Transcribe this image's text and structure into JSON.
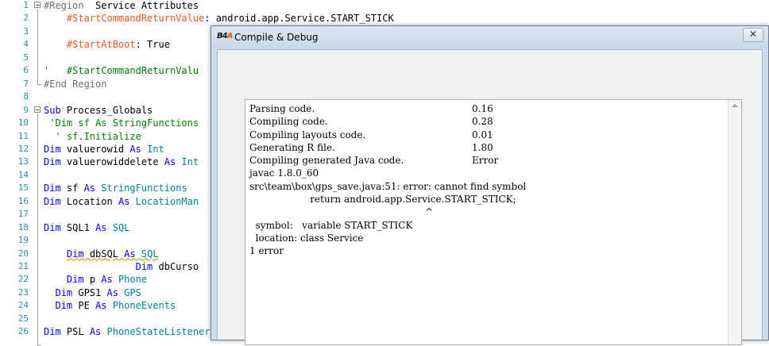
{
  "editor": {
    "lines": [
      {
        "num": "1",
        "segs": [
          {
            "c": "reg",
            "t": "#Region  "
          },
          {
            "c": "str",
            "t": "Service Attributes"
          }
        ]
      },
      {
        "num": "2",
        "segs": [
          {
            "c": "str",
            "t": "    "
          },
          {
            "c": "dir",
            "t": "#StartCommandReturnValue"
          },
          {
            "c": "str",
            "t": ": android.app.Service.START_STICK"
          }
        ]
      },
      {
        "num": "3",
        "segs": []
      },
      {
        "num": "4",
        "segs": [
          {
            "c": "str",
            "t": "    "
          },
          {
            "c": "dir",
            "t": "#StartAtBoot"
          },
          {
            "c": "str",
            "t": ": True"
          }
        ]
      },
      {
        "num": "5",
        "segs": []
      },
      {
        "num": "6",
        "segs": [
          {
            "c": "cm",
            "t": "'   "
          },
          {
            "c": "cm",
            "t": "#StartCommandReturnValu"
          }
        ]
      },
      {
        "num": "7",
        "segs": [
          {
            "c": "reg",
            "t": "#End Region"
          }
        ]
      },
      {
        "num": "8",
        "segs": []
      },
      {
        "num": "9",
        "segs": [
          {
            "c": "kw",
            "t": "Sub "
          },
          {
            "c": "str",
            "t": "Process_Globals"
          }
        ]
      },
      {
        "num": "10",
        "segs": [
          {
            "c": "cm",
            "t": " 'Dim sf As StringFunctions"
          }
        ]
      },
      {
        "num": "11",
        "segs": [
          {
            "c": "cm",
            "t": "  ' sf.Initialize"
          }
        ]
      },
      {
        "num": "12",
        "segs": [
          {
            "c": "kw",
            "t": "Dim "
          },
          {
            "c": "str",
            "t": "valuerowid "
          },
          {
            "c": "kw",
            "t": "As "
          },
          {
            "c": "ty",
            "t": "Int"
          }
        ]
      },
      {
        "num": "13",
        "segs": [
          {
            "c": "kw",
            "t": "Dim "
          },
          {
            "c": "str",
            "t": "valuerowiddelete "
          },
          {
            "c": "kw",
            "t": "As "
          },
          {
            "c": "ty",
            "t": "Int"
          }
        ]
      },
      {
        "num": "14",
        "segs": []
      },
      {
        "num": "15",
        "segs": [
          {
            "c": "kw",
            "t": "Dim "
          },
          {
            "c": "str",
            "t": "sf "
          },
          {
            "c": "kw",
            "t": "As "
          },
          {
            "c": "ty",
            "t": "StringFunctions"
          }
        ]
      },
      {
        "num": "16",
        "segs": [
          {
            "c": "kw",
            "t": "Dim "
          },
          {
            "c": "str",
            "t": "Location "
          },
          {
            "c": "kw",
            "t": "As "
          },
          {
            "c": "ty",
            "t": "LocationMan"
          }
        ]
      },
      {
        "num": "17",
        "segs": []
      },
      {
        "num": "18",
        "segs": [
          {
            "c": "kw",
            "t": "Dim "
          },
          {
            "c": "str",
            "t": "SQL1 "
          },
          {
            "c": "kw",
            "t": "As "
          },
          {
            "c": "ty",
            "t": "SQL"
          }
        ]
      },
      {
        "num": "19",
        "segs": []
      },
      {
        "num": "20",
        "segs": [
          {
            "c": "str",
            "t": "    "
          },
          {
            "c": "kw wavy",
            "t": "Dim "
          },
          {
            "c": "str wavy",
            "t": "dbSQL "
          },
          {
            "c": "kw wavy",
            "t": "As "
          },
          {
            "c": "ty wavy",
            "t": "SQL"
          }
        ]
      },
      {
        "num": "21",
        "segs": [
          {
            "c": "str",
            "t": "                "
          },
          {
            "c": "kw",
            "t": "Dim "
          },
          {
            "c": "str",
            "t": "dbCurso"
          }
        ]
      },
      {
        "num": "22",
        "segs": [
          {
            "c": "str",
            "t": "    "
          },
          {
            "c": "kw",
            "t": "Dim "
          },
          {
            "c": "str",
            "t": "p "
          },
          {
            "c": "kw",
            "t": "As "
          },
          {
            "c": "ty",
            "t": "Phone"
          }
        ]
      },
      {
        "num": "23",
        "segs": [
          {
            "c": "str",
            "t": "  "
          },
          {
            "c": "kw",
            "t": "Dim "
          },
          {
            "c": "str",
            "t": "GPS1 "
          },
          {
            "c": "kw",
            "t": "As "
          },
          {
            "c": "ty",
            "t": "GPS"
          }
        ]
      },
      {
        "num": "24",
        "segs": [
          {
            "c": "str",
            "t": "  "
          },
          {
            "c": "kw",
            "t": "Dim "
          },
          {
            "c": "str",
            "t": "PE "
          },
          {
            "c": "kw",
            "t": "As "
          },
          {
            "c": "ty",
            "t": "PhoneEvents"
          }
        ]
      },
      {
        "num": "25",
        "segs": []
      },
      {
        "num": "26",
        "segs": [
          {
            "c": "kw",
            "t": "Dim "
          },
          {
            "c": "str",
            "t": "PSL "
          },
          {
            "c": "kw",
            "t": "As "
          },
          {
            "c": "ty",
            "t": "PhoneStateListener"
          }
        ]
      }
    ]
  },
  "dialog": {
    "icon_text": "B4A",
    "title": "Compile & Debug",
    "close_glyph": "✕",
    "output_rows": [
      {
        "label": "Parsing code.",
        "value": "0.16"
      },
      {
        "label": "Compiling code.",
        "value": "0.28"
      },
      {
        "label": "Compiling layouts code.",
        "value": "0.01"
      },
      {
        "label": "Generating R file.",
        "value": "1.80"
      },
      {
        "label": "Compiling generated Java code.",
        "value": "Error"
      },
      {
        "label": "javac 1.8.0_60",
        "value": ""
      },
      {
        "label": "src\\team\\box\\gps_save.java:51: error: cannot find symbol",
        "value": ""
      },
      {
        "label": "                    return android.app.Service.START_STICK;",
        "value": ""
      },
      {
        "label": "                                                          ^",
        "value": ""
      },
      {
        "label": "  symbol:   variable START_STICK",
        "value": ""
      },
      {
        "label": "  location: class Service",
        "value": ""
      },
      {
        "label": "1 error",
        "value": ""
      }
    ]
  }
}
